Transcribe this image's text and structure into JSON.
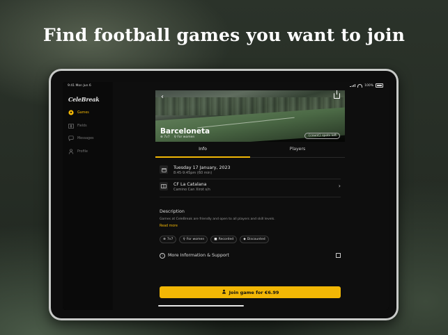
{
  "headline": "Find football games you want to join",
  "status": {
    "time": "9:41",
    "date": "Mon Jun 6",
    "battery": "100%"
  },
  "sidebar": {
    "logo": "CeleBreak",
    "items": [
      {
        "label": "Games",
        "icon": "football-icon",
        "active": true
      },
      {
        "label": "Fields",
        "icon": "field-icon",
        "active": false
      },
      {
        "label": "Messages",
        "icon": "chat-icon",
        "active": false
      },
      {
        "label": "Profile",
        "icon": "person-icon",
        "active": false
      }
    ]
  },
  "hero": {
    "title": "Barceloneta",
    "format": "7v7",
    "audience": "For women",
    "spots": "{count} spots left"
  },
  "tabs": [
    {
      "label": "Info"
    },
    {
      "label": "Players"
    }
  ],
  "details": {
    "date": "Tuesday 17 January, 2023",
    "time": "8:45-9:45pm (60 min)",
    "venue": "CF La Catalana",
    "address": "Camino Can Xirot s/n"
  },
  "description": {
    "heading": "Description",
    "body": "Games at CeleBreak are friendly and open to all players and skill levels.",
    "read_more": "Read more"
  },
  "chips": [
    {
      "label": "7v7",
      "icon": "ball-icon"
    },
    {
      "label": "For women",
      "icon": "female-icon"
    },
    {
      "label": "Recorded",
      "icon": "video-icon"
    },
    {
      "label": "Discounted",
      "icon": "tag-icon"
    }
  ],
  "more_info": {
    "label": "More Information & Support"
  },
  "cta": {
    "label": "Join game for €6.99"
  },
  "colors": {
    "accent": "#f2b705"
  }
}
